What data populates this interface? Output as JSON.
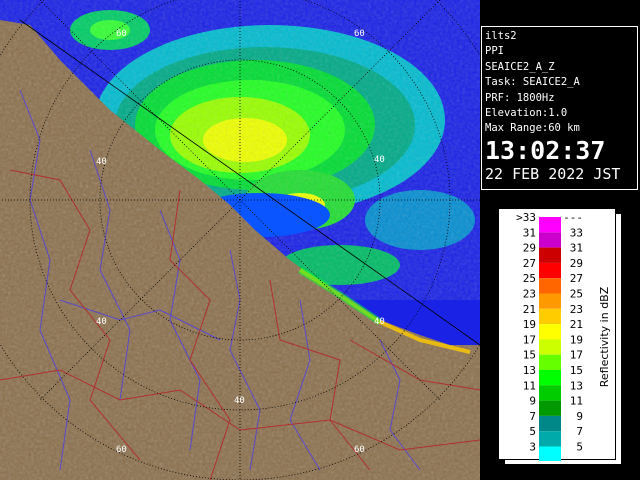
{
  "radar": {
    "site": "ilts2",
    "product": "PPI",
    "product_code": "SEAICE2_A_Z",
    "task": "Task: SEAICE2_A",
    "prf": "PRF: 1800Hz",
    "elevation": "Elevation:1.0",
    "max_range": "Max Range:60 km",
    "time": "13:02:37",
    "date": "22 FEB 2022 JST"
  },
  "range_labels": [
    {
      "text": "60",
      "pos": "top-left"
    },
    {
      "text": "60",
      "pos": "top-center"
    },
    {
      "text": "40",
      "pos": "left-upper"
    },
    {
      "text": "40",
      "pos": "right-upper"
    },
    {
      "text": "40",
      "pos": "left-lower"
    },
    {
      "text": "40",
      "pos": "right-lower"
    },
    {
      "text": "40",
      "pos": "bottom"
    },
    {
      "text": "60",
      "pos": "bottom-left"
    },
    {
      "text": "60",
      "pos": "bottom-right"
    }
  ],
  "legend": {
    "title": "Reflectivity in dBZ",
    "bins": [
      {
        "lo": ">33",
        "hi": "---",
        "color": "#ff00ff"
      },
      {
        "lo": "31",
        "hi": "33",
        "color": "#cc00cc"
      },
      {
        "lo": "29",
        "hi": "31",
        "color": "#cc0000"
      },
      {
        "lo": "27",
        "hi": "29",
        "color": "#ff0000"
      },
      {
        "lo": "25",
        "hi": "27",
        "color": "#ff6600"
      },
      {
        "lo": "23",
        "hi": "25",
        "color": "#ff9900"
      },
      {
        "lo": "21",
        "hi": "23",
        "color": "#ffcc00"
      },
      {
        "lo": "19",
        "hi": "21",
        "color": "#ffff00"
      },
      {
        "lo": "17",
        "hi": "19",
        "color": "#ccff00"
      },
      {
        "lo": "15",
        "hi": "17",
        "color": "#66ff00"
      },
      {
        "lo": "13",
        "hi": "15",
        "color": "#00ff00"
      },
      {
        "lo": "11",
        "hi": "13",
        "color": "#00cc00"
      },
      {
        "lo": "9",
        "hi": "11",
        "color": "#009900"
      },
      {
        "lo": "7",
        "hi": "9",
        "color": "#008888"
      },
      {
        "lo": "5",
        "hi": "7",
        "color": "#00aaaa"
      },
      {
        "lo": "3",
        "hi": "5",
        "color": "#00ffff"
      }
    ]
  },
  "colors": {
    "sea": "#1a22e6",
    "calm_sea": "#0a55ff",
    "land": "#8a6e4a",
    "rivers": "#5a4acc",
    "boundaries": "#b03030"
  }
}
